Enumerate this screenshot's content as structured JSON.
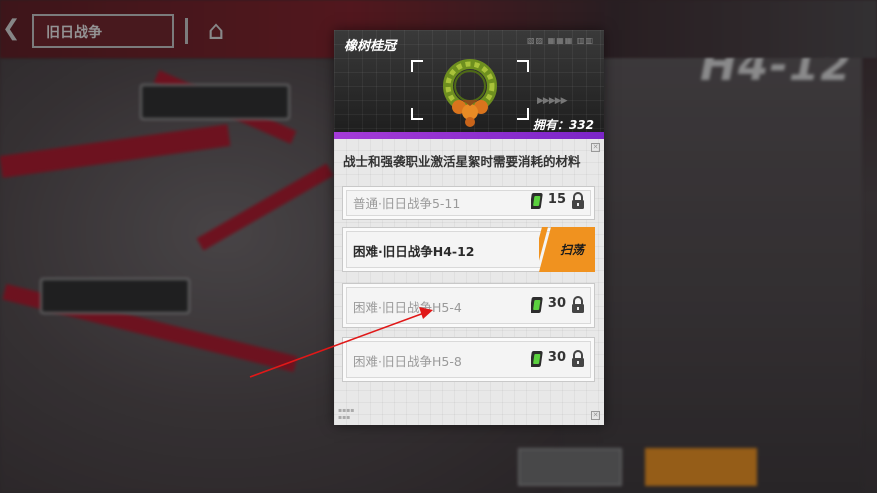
{
  "background": {
    "top_title": "旧日战争",
    "stage_code": "H4-12"
  },
  "popup": {
    "item_name": "橡树桂冠",
    "owned_label": "拥有：",
    "owned_count": "332",
    "description": "战士和强袭职业激活星絮时需要消耗的材料",
    "sources": [
      {
        "name": "普通·旧日战争5-11",
        "cost": "15",
        "locked": true
      },
      {
        "name": "困难·旧日战争H4-12",
        "cost": "",
        "locked": false,
        "action": "扫荡"
      },
      {
        "name": "困难·旧日战争H5-4",
        "cost": "30",
        "locked": true
      },
      {
        "name": "困难·旧日战争H5-8",
        "cost": "30",
        "locked": true
      }
    ]
  },
  "colors": {
    "accent_purple": "#9a32d4",
    "sweep_orange": "#f0921f",
    "annotation_red": "#e01818",
    "ticket_green": "#3fa33a"
  }
}
